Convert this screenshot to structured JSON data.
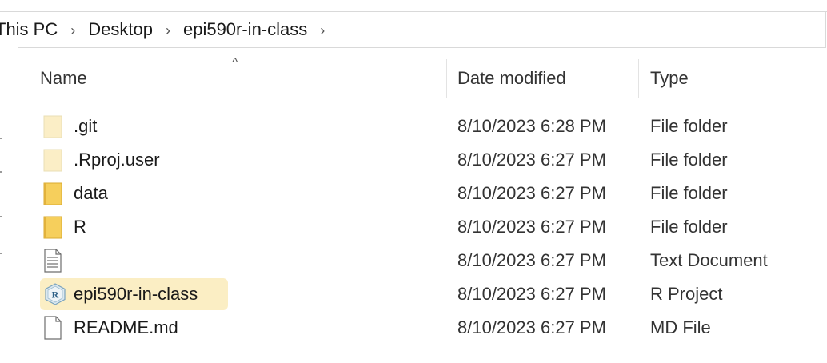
{
  "address": {
    "crumbs": [
      "This PC",
      "Desktop",
      "epi590r-in-class"
    ],
    "separator": "›"
  },
  "columns": {
    "sort_indicator": "^",
    "name": "Name",
    "date_modified": "Date modified",
    "type": "Type"
  },
  "files": [
    {
      "name": ".git",
      "date": "8/10/2023 6:28 PM",
      "type": "File folder",
      "icon": "folder-faded-icon"
    },
    {
      "name": ".Rproj.user",
      "date": "8/10/2023 6:27 PM",
      "type": "File folder",
      "icon": "folder-faded-icon"
    },
    {
      "name": "data",
      "date": "8/10/2023 6:27 PM",
      "type": "File folder",
      "icon": "folder-icon"
    },
    {
      "name": "R",
      "date": "8/10/2023 6:27 PM",
      "type": "File folder",
      "icon": "folder-icon"
    },
    {
      "name": "",
      "date": "8/10/2023 6:27 PM",
      "type": "Text Document",
      "icon": "text-document-icon"
    },
    {
      "name": "epi590r-in-class",
      "date": "8/10/2023 6:27 PM",
      "type": "R Project",
      "icon": "r-project-icon",
      "highlighted": true
    },
    {
      "name": "README.md",
      "date": "8/10/2023 6:27 PM",
      "type": "MD File",
      "icon": "blank-file-icon"
    }
  ],
  "colors": {
    "highlight": "#fbeec4",
    "folder": "#f6cf5c",
    "folder_faded": "#fbeec6"
  }
}
